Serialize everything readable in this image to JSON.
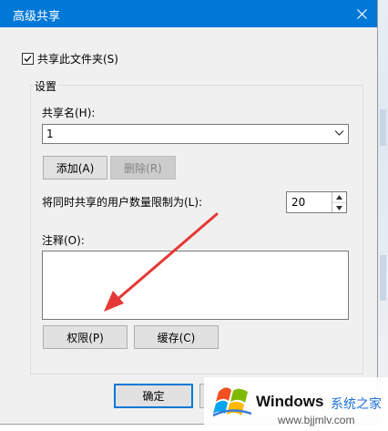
{
  "dialog": {
    "title": "高级共享",
    "share_checkbox": {
      "label": "共享此文件夹(S)",
      "checked": true
    },
    "settings_group": "设置",
    "share_name_label": "共享名(H):",
    "share_name_value": "1",
    "add_button": "添加(A)",
    "remove_button": "删除(R)",
    "user_limit_label": "将同时共享的用户数量限制为(L):",
    "user_limit_value": "20",
    "comment_label": "注释(O):",
    "comment_value": "",
    "permissions_button": "权限(P)",
    "caching_button": "缓存(C)",
    "ok_button": "确定"
  },
  "watermark": {
    "title": "Windows",
    "brand": "系统之家",
    "url": "www.bjjmlv.com"
  },
  "colors": {
    "titlebar": "#0078d7",
    "dialog_bg": "#f0f0f0",
    "annotation_arrow": "#e53935"
  }
}
